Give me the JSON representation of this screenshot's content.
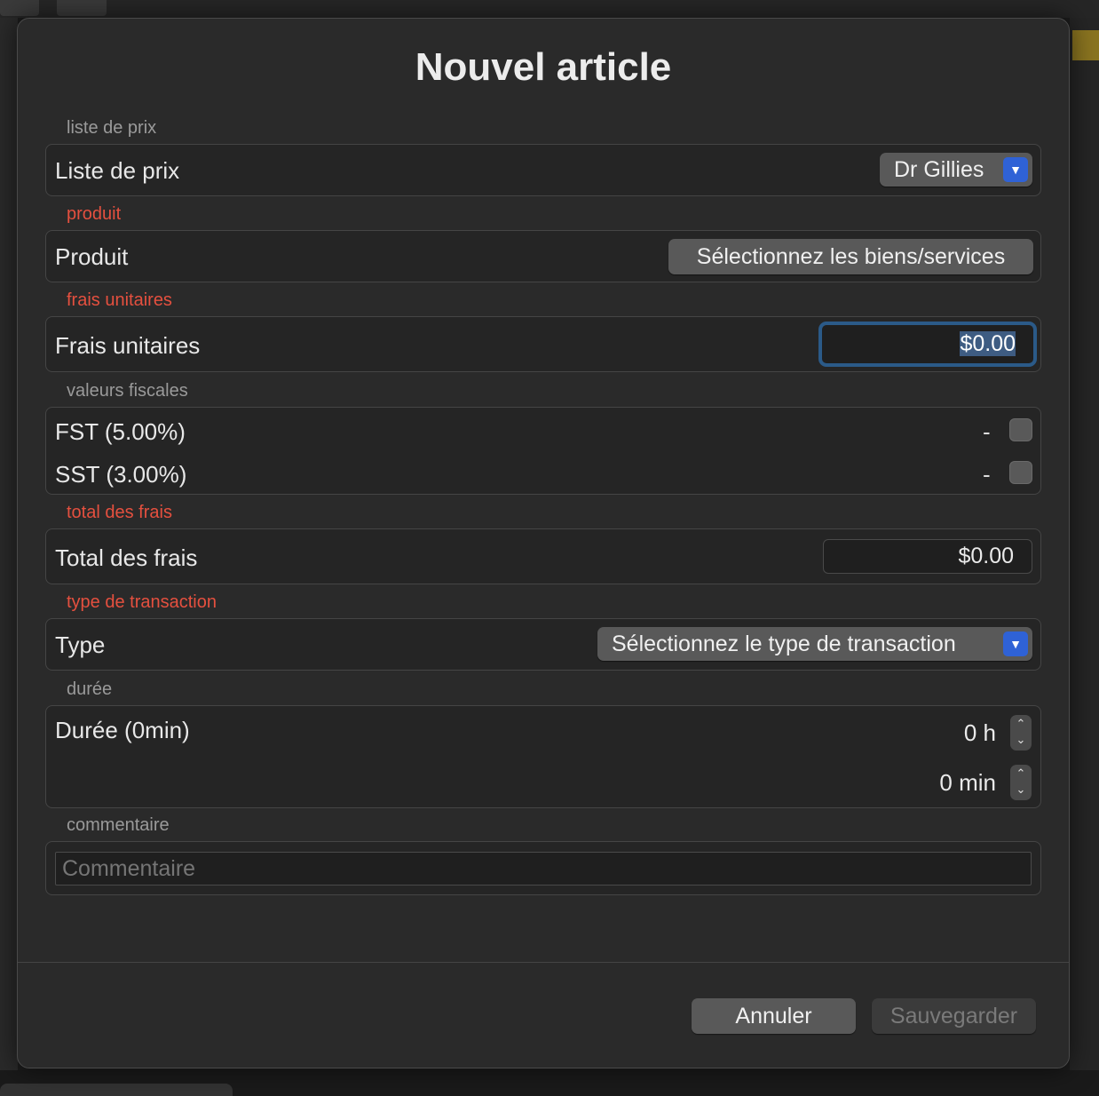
{
  "dialog": {
    "title": "Nouvel article"
  },
  "price_list": {
    "section": "liste de prix",
    "label": "Liste de prix",
    "value": "Dr Gillies"
  },
  "product": {
    "section": "produit",
    "label": "Produit",
    "button": "Sélectionnez les biens/services"
  },
  "unit_fee": {
    "section": "frais unitaires",
    "label": "Frais unitaires",
    "value": "$0.00"
  },
  "taxes": {
    "section": "valeurs fiscales",
    "items": [
      {
        "label": "FST (5.00%)",
        "amount": "-",
        "checked": false
      },
      {
        "label": "SST (3.00%)",
        "amount": "-",
        "checked": false
      }
    ]
  },
  "total": {
    "section": "total des frais",
    "label": "Total des frais",
    "value": "$0.00"
  },
  "transaction": {
    "section": "type de transaction",
    "label": "Type",
    "value": "Sélectionnez le type de transaction"
  },
  "duration": {
    "section": "durée",
    "label": "Durée (0min)",
    "hours": "0 h",
    "minutes": "0 min"
  },
  "comment": {
    "section": "commentaire",
    "placeholder": "Commentaire"
  },
  "actions": {
    "cancel": "Annuler",
    "save": "Sauvegarder"
  },
  "colors": {
    "required_label": "#e5503f",
    "accent": "#2f62d6",
    "focus_ring": "#2b5a88"
  }
}
